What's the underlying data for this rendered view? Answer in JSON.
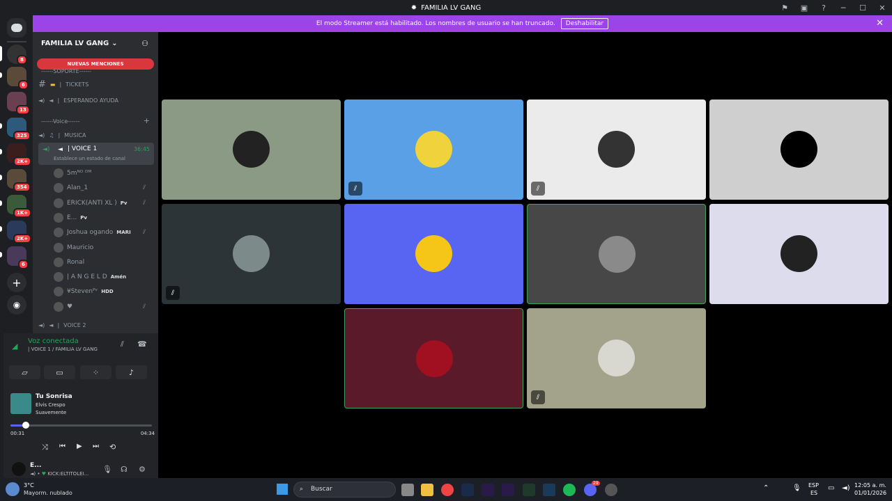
{
  "window": {
    "title": "FAMILIA LV GANG"
  },
  "banner": {
    "text": "El modo Streamer está habilitado. Los nombres de usuario se han truncado.",
    "button": "Deshabilitar"
  },
  "guild_badges": [
    "8",
    "6",
    "13",
    "325",
    "2K+",
    "354",
    "1K+",
    "2K+",
    "6"
  ],
  "server": {
    "name": "FAMILIA LV GANG",
    "new_mentions": "NUEVAS MENCIONES"
  },
  "channels": {
    "category_support": "------SOPORTE------",
    "tickets": "TICKETS",
    "waiting": "ESPERANDO AYUDA",
    "category_voice": "------Voice------",
    "music": "MUSICA",
    "voice1": "VOICE 1",
    "voice1_time": "36:45",
    "voice1_status": "Establece un estado de canal",
    "voice2": "VOICE 2"
  },
  "voice_users": [
    {
      "name": "5mᴺᴼ ᴰᴹ",
      "tag": "",
      "muted": false
    },
    {
      "name": "Alan_1",
      "tag": "",
      "muted": true
    },
    {
      "name": "ERICK(ANTI XL )",
      "tag": "Pv",
      "muted": true
    },
    {
      "name": "E...",
      "tag": "Pv",
      "muted": false
    },
    {
      "name": "Joshua ogando",
      "tag": "MARI",
      "muted": true
    },
    {
      "name": "Mauricio",
      "tag": "",
      "muted": false
    },
    {
      "name": "Ronal",
      "tag": "",
      "muted": false
    },
    {
      "name": "| A N G E L D",
      "tag": "Amén",
      "muted": false
    },
    {
      "name": "¥Stevenᴾᵛ",
      "tag": "HDD",
      "muted": false
    },
    {
      "name": "♥",
      "tag": "",
      "muted": true
    }
  ],
  "voice_connection": {
    "status": "Voz conectada",
    "location": "| VOICE 1 / FAMILIA LV GANG"
  },
  "music": {
    "title": "Tu Sonrisa",
    "artist": "Elvis Crespo",
    "album": "Suavemente",
    "elapsed": "00:31",
    "total": "04:34",
    "progress": 0.11
  },
  "user": {
    "name": "E...",
    "status": "KICK:ELTITOLEI..."
  },
  "tiles": [
    {
      "bg": "#8b9a84",
      "avatar": "#222",
      "muted": false,
      "speaking": false
    },
    {
      "bg": "#5aa0e6",
      "avatar": "#f0d23c",
      "muted": true,
      "speaking": false
    },
    {
      "bg": "#ebebeb",
      "avatar": "#333",
      "muted": true,
      "speaking": false
    },
    {
      "bg": "#cfcfcf",
      "avatar": "#000",
      "muted": false,
      "speaking": false
    },
    {
      "bg": "#2d3438",
      "avatar": "#7d8a8a",
      "muted": true,
      "speaking": false
    },
    {
      "bg": "#5865f2",
      "avatar": "#f5c518",
      "muted": false,
      "speaking": false
    },
    {
      "bg": "#474747",
      "avatar": "#8a8a8a",
      "muted": false,
      "speaking": true
    },
    {
      "bg": "#dcdcec",
      "avatar": "#222",
      "muted": false,
      "speaking": false
    },
    {
      "bg": "#5a1a2a",
      "avatar": "#a01020",
      "muted": false,
      "speaking": true
    },
    {
      "bg": "#a3a38b",
      "avatar": "#d8d8d0",
      "muted": true,
      "speaking": false
    }
  ],
  "taskbar": {
    "weather_temp": "3°C",
    "weather_desc": "Mayorm. nublado",
    "search": "Buscar",
    "lang1": "ESP",
    "lang2": "ES",
    "time": "12:05 a. m.",
    "date": "01/01/2026",
    "discord_badge": "29"
  }
}
